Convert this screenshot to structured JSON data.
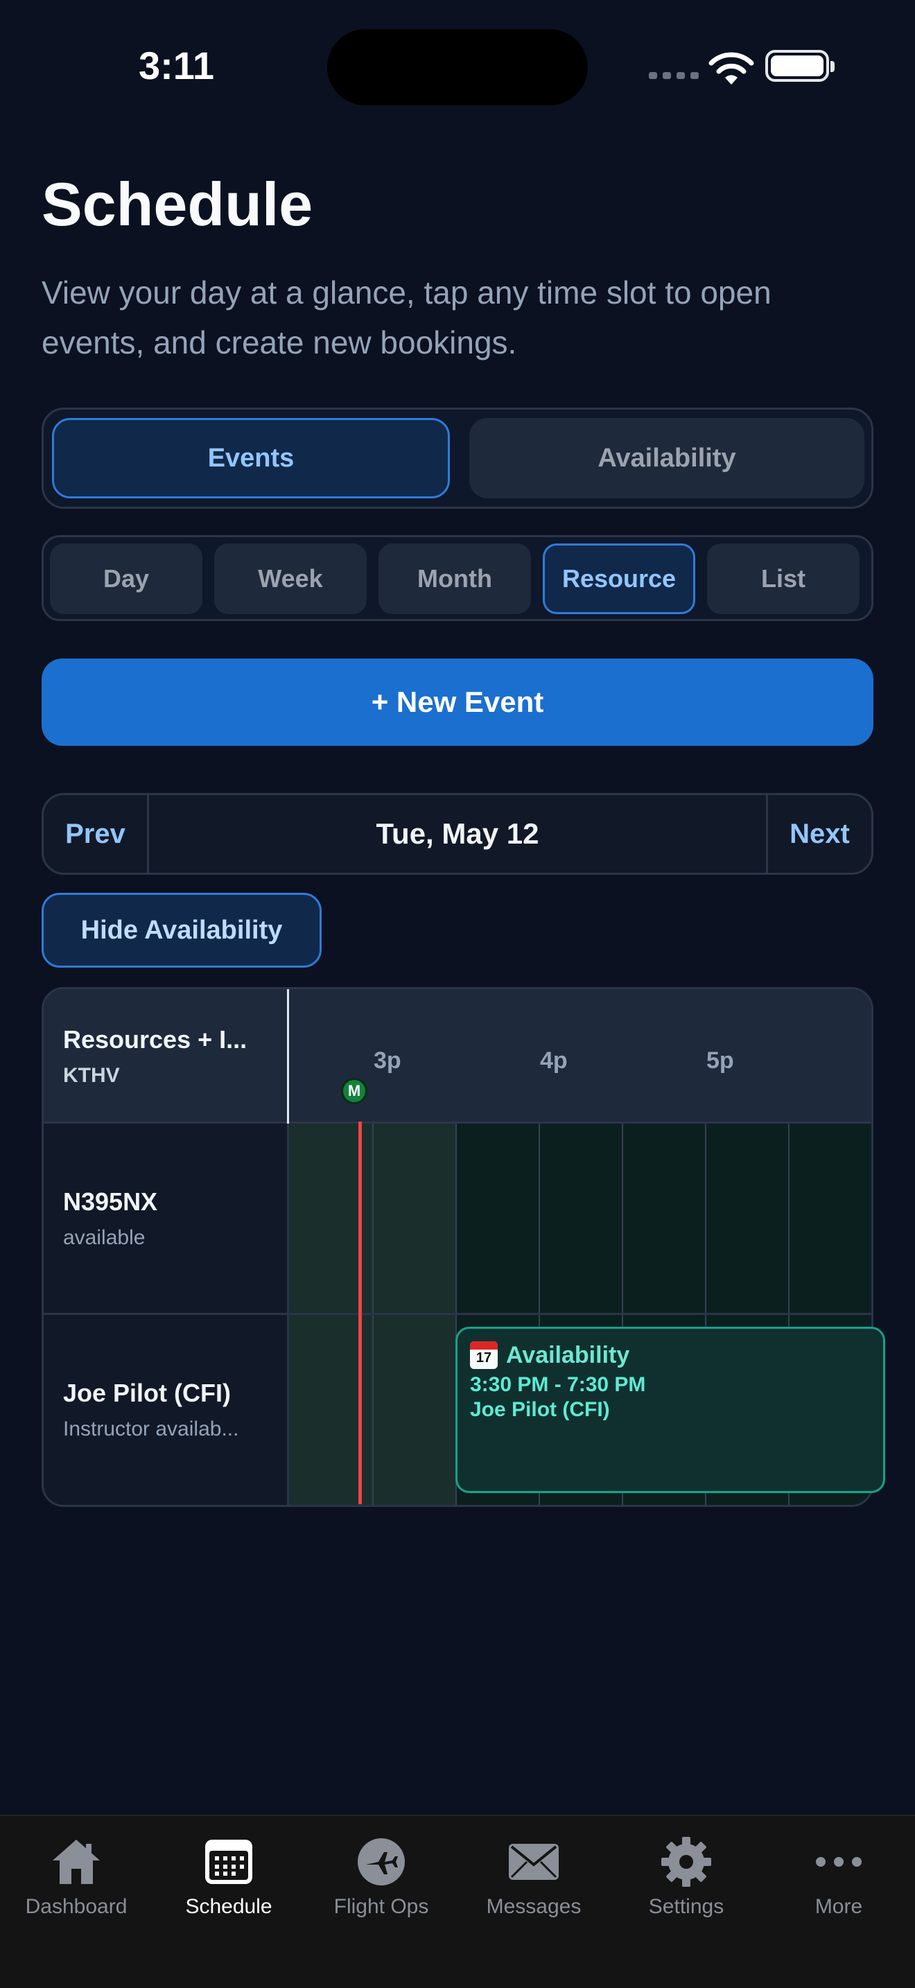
{
  "status": {
    "time": "3:11"
  },
  "header": {
    "title": "Schedule",
    "subtitle": "View your day at a glance, tap any time slot to open events, and create new bookings."
  },
  "mode_toggle": {
    "events": "Events",
    "availability": "Availability",
    "selected": "Events"
  },
  "view_tabs": {
    "day": "Day",
    "week": "Week",
    "month": "Month",
    "resource": "Resource",
    "list": "List",
    "selected": "Resource"
  },
  "new_event": "+ New Event",
  "date_nav": {
    "prev": "Prev",
    "date": "Tue, May 12",
    "next": "Next"
  },
  "hide_availability": "Hide Availability",
  "grid": {
    "header_title": "Resources + I...",
    "header_sub": "KTHV",
    "hours": [
      "3p",
      "4p",
      "5p"
    ],
    "marker": "M",
    "rows": [
      {
        "name": "N395NX",
        "sub": "available"
      },
      {
        "name": "Joe Pilot (CFI)",
        "sub": "Instructor availab..."
      }
    ],
    "event": {
      "title": "Availability",
      "time": "3:30 PM - 7:30 PM",
      "who": "Joe Pilot (CFI)",
      "icon_day": "17"
    }
  },
  "tabbar": {
    "dashboard": "Dashboard",
    "schedule": "Schedule",
    "flight_ops": "Flight Ops",
    "messages": "Messages",
    "settings": "Settings",
    "more": "More",
    "active": "Schedule"
  },
  "colors": {
    "accent": "#1b6fcf",
    "now_line": "#ef4444",
    "availability": "#14a38b"
  }
}
